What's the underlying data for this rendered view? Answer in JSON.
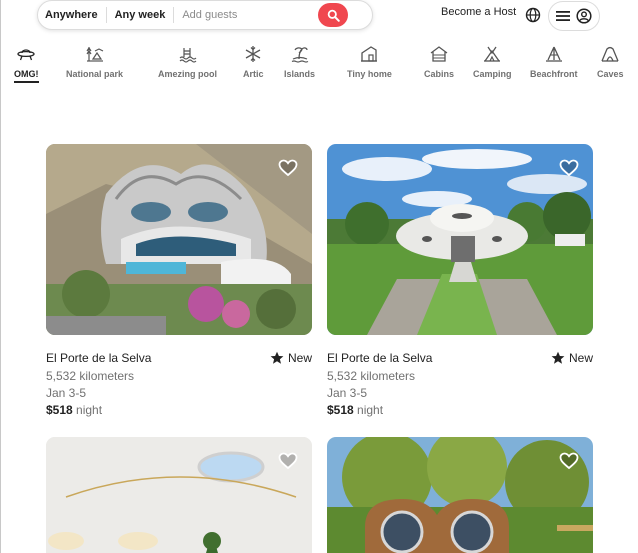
{
  "search": {
    "anywhere": "Anywhere",
    "any_week": "Any week",
    "guests_placeholder": "Add guests"
  },
  "header": {
    "host_link": "Become a Host"
  },
  "colors": {
    "accent": "#f0474f",
    "text": "#222222",
    "muted": "#717171"
  },
  "categories": [
    {
      "label": "OMG!",
      "icon": "ufo-icon",
      "active": true
    },
    {
      "label": "National park",
      "icon": "park-icon"
    },
    {
      "label": "Amezing pool",
      "icon": "pool-icon"
    },
    {
      "label": "Artic",
      "icon": "snowflake-icon"
    },
    {
      "label": "Islands",
      "icon": "island-icon"
    },
    {
      "label": "Tiny home",
      "icon": "tiny-home-icon"
    },
    {
      "label": "Cabins",
      "icon": "cabin-icon"
    },
    {
      "label": "Camping",
      "icon": "tent-icon"
    },
    {
      "label": "Beachfront",
      "icon": "beach-icon"
    },
    {
      "label": "Caves",
      "icon": "cave-icon"
    }
  ],
  "listings": [
    {
      "title": "El Porte de la Selva",
      "rating": "New",
      "distance": "5,532 kilometers",
      "dates": "Jan 3-5",
      "price": "$518",
      "price_unit": "night"
    },
    {
      "title": "El Porte de la Selva",
      "rating": "New",
      "distance": "5,532 kilometers",
      "dates": "Jan 3-5",
      "price": "$518",
      "price_unit": "night"
    },
    {},
    {}
  ]
}
